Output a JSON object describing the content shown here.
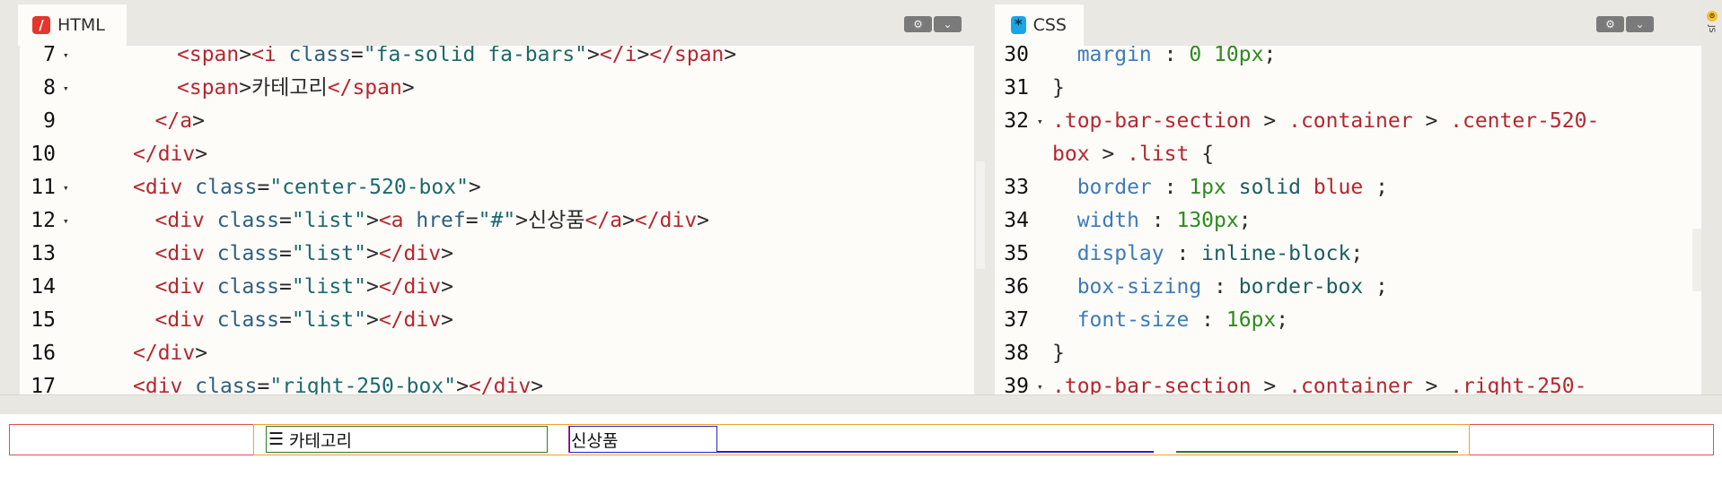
{
  "html_panel": {
    "tab_label": "HTML",
    "tab_icon": "html-slash-icon",
    "lines": [
      {
        "num": "7",
        "fold": true,
        "indent": 6,
        "tokens": [
          [
            "t",
            "<"
          ],
          [
            "t",
            "span"
          ],
          [
            "p",
            ">"
          ],
          [
            "t",
            "<"
          ],
          [
            "t",
            "i"
          ],
          [
            "a",
            " class"
          ],
          [
            "p",
            "="
          ],
          [
            "v",
            "\"fa-solid fa-bars\""
          ],
          [
            "p",
            ">"
          ],
          [
            "t",
            "</"
          ],
          [
            "t",
            "i"
          ],
          [
            "p",
            ">"
          ],
          [
            "t",
            "</"
          ],
          [
            "t",
            "span"
          ],
          [
            "p",
            ">"
          ]
        ]
      },
      {
        "num": "8",
        "fold": true,
        "indent": 6,
        "tokens": [
          [
            "t",
            "<"
          ],
          [
            "t",
            "span"
          ],
          [
            "p",
            ">카테고리"
          ],
          [
            "t",
            "</"
          ],
          [
            "t",
            "span"
          ],
          [
            "p",
            ">"
          ]
        ]
      },
      {
        "num": "9",
        "fold": false,
        "indent": 5,
        "tokens": [
          [
            "t",
            "</"
          ],
          [
            "t",
            "a"
          ],
          [
            "p",
            ">"
          ]
        ]
      },
      {
        "num": "10",
        "fold": false,
        "indent": 4,
        "tokens": [
          [
            "t",
            "</"
          ],
          [
            "t",
            "div"
          ],
          [
            "p",
            ">"
          ]
        ]
      },
      {
        "num": "11",
        "fold": true,
        "indent": 4,
        "tokens": [
          [
            "t",
            "<"
          ],
          [
            "t",
            "div"
          ],
          [
            "a",
            " class"
          ],
          [
            "p",
            "="
          ],
          [
            "v",
            "\"center-520-box\""
          ],
          [
            "p",
            ">"
          ]
        ]
      },
      {
        "num": "12",
        "fold": true,
        "indent": 5,
        "tokens": [
          [
            "t",
            "<"
          ],
          [
            "t",
            "div"
          ],
          [
            "a",
            " class"
          ],
          [
            "p",
            "="
          ],
          [
            "v",
            "\"list\""
          ],
          [
            "p",
            ">"
          ],
          [
            "t",
            "<a"
          ],
          [
            "a",
            " href"
          ],
          [
            "p",
            "="
          ],
          [
            "v",
            "\"#\""
          ],
          [
            "p",
            ">신상품"
          ],
          [
            "t",
            "</"
          ],
          [
            "t",
            "a"
          ],
          [
            "p",
            ">"
          ],
          [
            "t",
            "</"
          ],
          [
            "t",
            "div"
          ],
          [
            "p",
            ">"
          ]
        ]
      },
      {
        "num": "13",
        "fold": false,
        "indent": 5,
        "tokens": [
          [
            "t",
            "<"
          ],
          [
            "t",
            "div"
          ],
          [
            "a",
            " class"
          ],
          [
            "p",
            "="
          ],
          [
            "v",
            "\"list\""
          ],
          [
            "p",
            ">"
          ],
          [
            "t",
            "</"
          ],
          [
            "t",
            "div"
          ],
          [
            "p",
            ">"
          ]
        ]
      },
      {
        "num": "14",
        "fold": false,
        "indent": 5,
        "tokens": [
          [
            "t",
            "<"
          ],
          [
            "t",
            "div"
          ],
          [
            "a",
            " class"
          ],
          [
            "p",
            "="
          ],
          [
            "v",
            "\"list\""
          ],
          [
            "p",
            ">"
          ],
          [
            "t",
            "</"
          ],
          [
            "t",
            "div"
          ],
          [
            "p",
            ">"
          ]
        ]
      },
      {
        "num": "15",
        "fold": false,
        "indent": 5,
        "tokens": [
          [
            "t",
            "<"
          ],
          [
            "t",
            "div"
          ],
          [
            "a",
            " class"
          ],
          [
            "p",
            "="
          ],
          [
            "v",
            "\"list\""
          ],
          [
            "p",
            ">"
          ],
          [
            "t",
            "</"
          ],
          [
            "t",
            "div"
          ],
          [
            "p",
            ">"
          ]
        ]
      },
      {
        "num": "16",
        "fold": false,
        "indent": 4,
        "tokens": [
          [
            "t",
            "</"
          ],
          [
            "t",
            "div"
          ],
          [
            "p",
            ">"
          ]
        ]
      },
      {
        "num": "17",
        "fold": false,
        "indent": 4,
        "tokens": [
          [
            "t",
            "<"
          ],
          [
            "t",
            "div"
          ],
          [
            "a",
            " class"
          ],
          [
            "p",
            "="
          ],
          [
            "v",
            "\"right-250-box\""
          ],
          [
            "p",
            ">"
          ],
          [
            "t",
            "</"
          ],
          [
            "t",
            "div"
          ],
          [
            "p",
            ">"
          ]
        ]
      }
    ]
  },
  "css_panel": {
    "tab_label": "CSS",
    "tab_icon": "css-asterisk-icon",
    "lines": [
      {
        "num": "30",
        "fold": false,
        "tokens": [
          [
            "pr",
            "  margin"
          ],
          [
            "p",
            " : "
          ],
          [
            "nm",
            "0"
          ],
          [
            "p",
            " "
          ],
          [
            "nm",
            "10px"
          ],
          [
            "p",
            ";"
          ]
        ]
      },
      {
        "num": "31",
        "fold": false,
        "tokens": [
          [
            "p",
            "}"
          ]
        ]
      },
      {
        "num": "32",
        "fold": true,
        "tokens": [
          [
            "s",
            ".top-bar-section"
          ],
          [
            "p",
            " > "
          ],
          [
            "s",
            ".container"
          ],
          [
            "p",
            " > "
          ],
          [
            "s",
            ".center-520-"
          ]
        ]
      },
      {
        "num": "",
        "fold": false,
        "tokens": [
          [
            "s",
            "box"
          ],
          [
            "p",
            " > "
          ],
          [
            "s",
            ".list"
          ],
          [
            "p",
            " {"
          ]
        ]
      },
      {
        "num": "33",
        "fold": false,
        "tokens": [
          [
            "pr",
            "  border"
          ],
          [
            "p",
            " : "
          ],
          [
            "nm",
            "1px"
          ],
          [
            "kw",
            " solid"
          ],
          [
            "rd",
            " blue"
          ],
          [
            "p",
            " ;"
          ]
        ]
      },
      {
        "num": "34",
        "fold": false,
        "tokens": [
          [
            "pr",
            "  width"
          ],
          [
            "p",
            " : "
          ],
          [
            "nm",
            "130px"
          ],
          [
            "p",
            ";"
          ]
        ]
      },
      {
        "num": "35",
        "fold": false,
        "tokens": [
          [
            "pr",
            "  display"
          ],
          [
            "p",
            " : "
          ],
          [
            "kw",
            "inline-block"
          ],
          [
            "p",
            ";"
          ]
        ]
      },
      {
        "num": "36",
        "fold": false,
        "tokens": [
          [
            "pr",
            "  box-sizing"
          ],
          [
            "p",
            " : "
          ],
          [
            "kw",
            "border-box"
          ],
          [
            "p",
            " ;"
          ]
        ]
      },
      {
        "num": "37",
        "fold": false,
        "tokens": [
          [
            "pr",
            "  font-size"
          ],
          [
            "p",
            " : "
          ],
          [
            "nm",
            "16px"
          ],
          [
            "p",
            ";"
          ]
        ]
      },
      {
        "num": "38",
        "fold": false,
        "tokens": [
          [
            "p",
            "}"
          ]
        ]
      },
      {
        "num": "39",
        "fold": true,
        "tokens": [
          [
            "s",
            ".top-bar-section"
          ],
          [
            "p",
            " > "
          ],
          [
            "s",
            ".container"
          ],
          [
            "p",
            " > "
          ],
          [
            "s",
            ".right-250-"
          ]
        ]
      }
    ]
  },
  "js_tab": {
    "label": "JS",
    "icon": "js-dot-icon"
  },
  "header_buttons": {
    "settings_icon": "gear-icon",
    "collapse_icon": "chevron-down-icon"
  },
  "result": {
    "category_icon": "bars-icon",
    "category_label": "카테고리",
    "new_products_link": "신상품"
  }
}
